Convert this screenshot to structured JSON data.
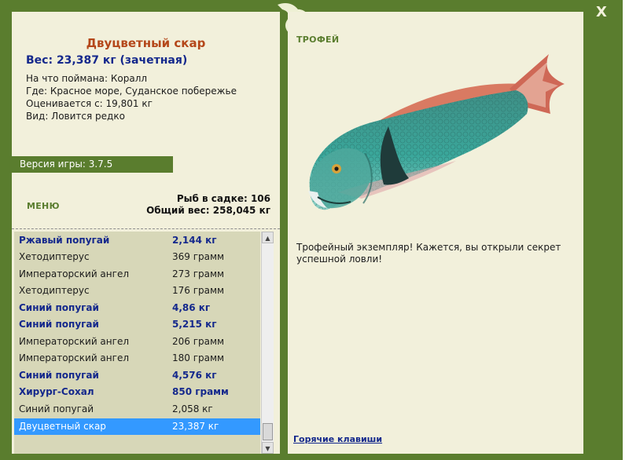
{
  "window": {
    "close_label": "X"
  },
  "catch": {
    "title": "Двуцветный скар",
    "weight_line": "Вес: 23,387 кг (зачетная)",
    "bait_line": "На что поймана: Коралл",
    "location_line": "Где: Красное море, Суданское побережье",
    "rating_line": "Оценивается с: 19,801 кг",
    "rarity_line": "Вид: Ловится редко"
  },
  "version_line": "Версия игры: 3.7.5",
  "menu_label": "МЕНЮ",
  "stats": {
    "count_line": "Рыб в садке: 106",
    "total_line": "Общий вес: 258,045 кг"
  },
  "fish_list": [
    {
      "name": "Ржавый попугай",
      "weight": "2,144 кг"
    },
    {
      "name": "Хетодиптерус",
      "weight": "369 грамм"
    },
    {
      "name": "Императорский ангел",
      "weight": "273 грамм"
    },
    {
      "name": "Хетодиптерус",
      "weight": "176 грамм"
    },
    {
      "name": "Синий попугай",
      "weight": "4,86 кг"
    },
    {
      "name": "Синий попугай",
      "weight": "5,215 кг"
    },
    {
      "name": "Императорский ангел",
      "weight": "206 грамм"
    },
    {
      "name": "Императорский ангел",
      "weight": "180 грамм"
    },
    {
      "name": "Синий попугай",
      "weight": "4,576 кг"
    },
    {
      "name": "Хирург-Сохал",
      "weight": "850 грамм"
    },
    {
      "name": "Синий попугай",
      "weight": "2,058 кг"
    },
    {
      "name": "Двуцветный скар",
      "weight": "23,387 кг"
    }
  ],
  "trophy": {
    "label": "ТРОФЕЙ",
    "text": "Трофейный экземпляр! Кажется, вы открыли секрет успешной ловли!"
  },
  "hotkeys_label": "Горячие клавиши",
  "colors": {
    "frame_green": "#5a7d2e",
    "panel_bg": "#f2f0db",
    "title_orange": "#b4471a",
    "highlight_blue": "#14288c",
    "selection_blue": "#3399ff"
  }
}
